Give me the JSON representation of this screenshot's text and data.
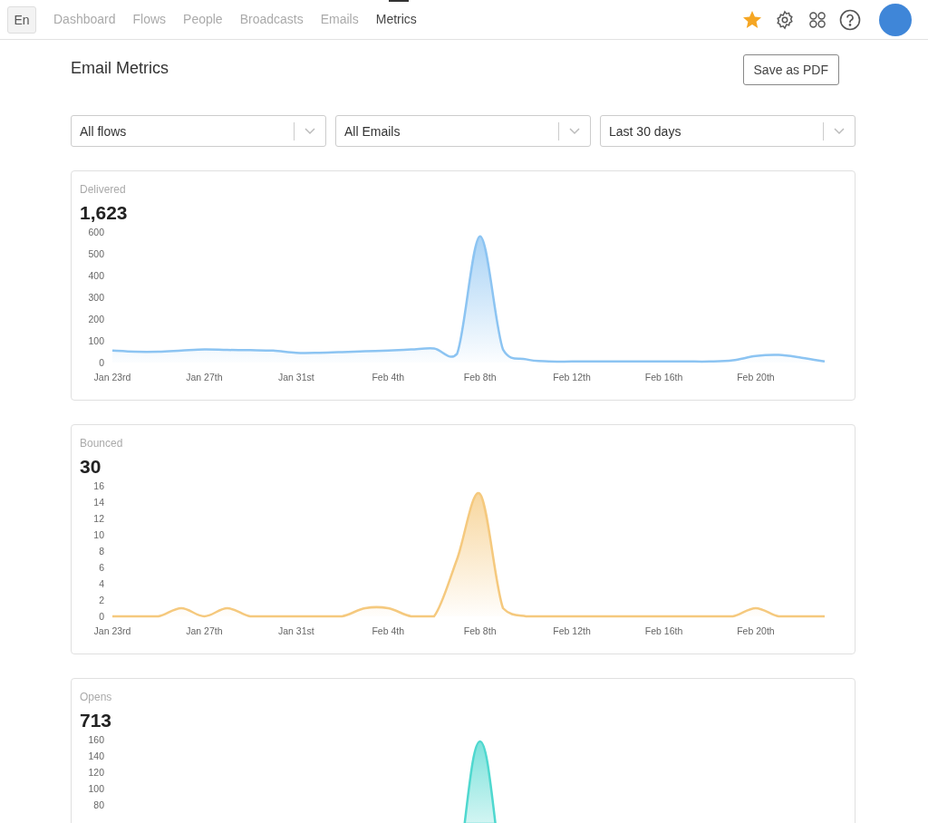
{
  "nav": {
    "language": "En",
    "items": [
      {
        "label": "Dashboard",
        "selected": false
      },
      {
        "label": "Flows",
        "selected": false
      },
      {
        "label": "People",
        "selected": false
      },
      {
        "label": "Broadcasts",
        "selected": false
      },
      {
        "label": "Emails",
        "selected": false
      },
      {
        "label": "Metrics",
        "selected": true
      }
    ]
  },
  "page": {
    "title": "Email Metrics",
    "action": "Save as PDF"
  },
  "filters": [
    {
      "value": "All flows"
    },
    {
      "value": "All Emails"
    },
    {
      "value": "Last 30 days"
    }
  ],
  "metrics": [
    {
      "label": "Delivered",
      "total": "1,623",
      "chart_data": {
        "type": "area",
        "categories": [
          "Jan 23rd",
          null,
          null,
          null,
          "Jan 27th",
          null,
          null,
          null,
          "Jan 31st",
          null,
          null,
          null,
          "Feb 4th",
          null,
          null,
          null,
          "Feb 8th",
          null,
          null,
          null,
          "Feb 12th",
          null,
          null,
          null,
          "Feb 16th",
          null,
          null,
          null,
          "Feb 20th",
          null,
          null,
          null
        ],
        "ylim": [
          0,
          600
        ],
        "yticks": [
          0,
          100,
          200,
          300,
          400,
          500,
          600
        ],
        "series": [
          {
            "color": "#8cc4f2",
            "values": [
              55,
              50,
              50,
              55,
              60,
              58,
              57,
              55,
              45,
              45,
              48,
              52,
              55,
              60,
              65,
              40,
              580,
              60,
              15,
              5,
              5,
              5,
              5,
              5,
              5,
              5,
              5,
              10,
              30,
              35,
              22,
              5
            ]
          }
        ]
      }
    },
    {
      "label": "Bounced",
      "total": "30",
      "chart_data": {
        "type": "area",
        "categories": [
          "Jan 23rd",
          null,
          null,
          null,
          "Jan 27th",
          null,
          null,
          null,
          "Jan 31st",
          null,
          null,
          null,
          "Feb 4th",
          null,
          null,
          null,
          "Feb 8th",
          null,
          null,
          null,
          "Feb 12th",
          null,
          null,
          null,
          "Feb 16th",
          null,
          null,
          null,
          "Feb 20th",
          null,
          null,
          null
        ],
        "ylim": [
          0,
          16
        ],
        "yticks": [
          0,
          2,
          4,
          6,
          8,
          10,
          12,
          14,
          16
        ],
        "series": [
          {
            "color": "#f5c97e",
            "values": [
              0,
              0,
              0,
              1,
              0,
              1,
              0,
              0,
              0,
              0,
              0,
              1,
              1,
              0,
              0,
              7,
              15,
              1,
              0,
              0,
              0,
              0,
              0,
              0,
              0,
              0,
              0,
              0,
              1,
              0,
              0,
              0
            ]
          }
        ]
      }
    },
    {
      "label": "Opens",
      "total": "713",
      "axis_labels": [
        "160",
        "140",
        "120",
        "100",
        "80"
      ]
    }
  ]
}
